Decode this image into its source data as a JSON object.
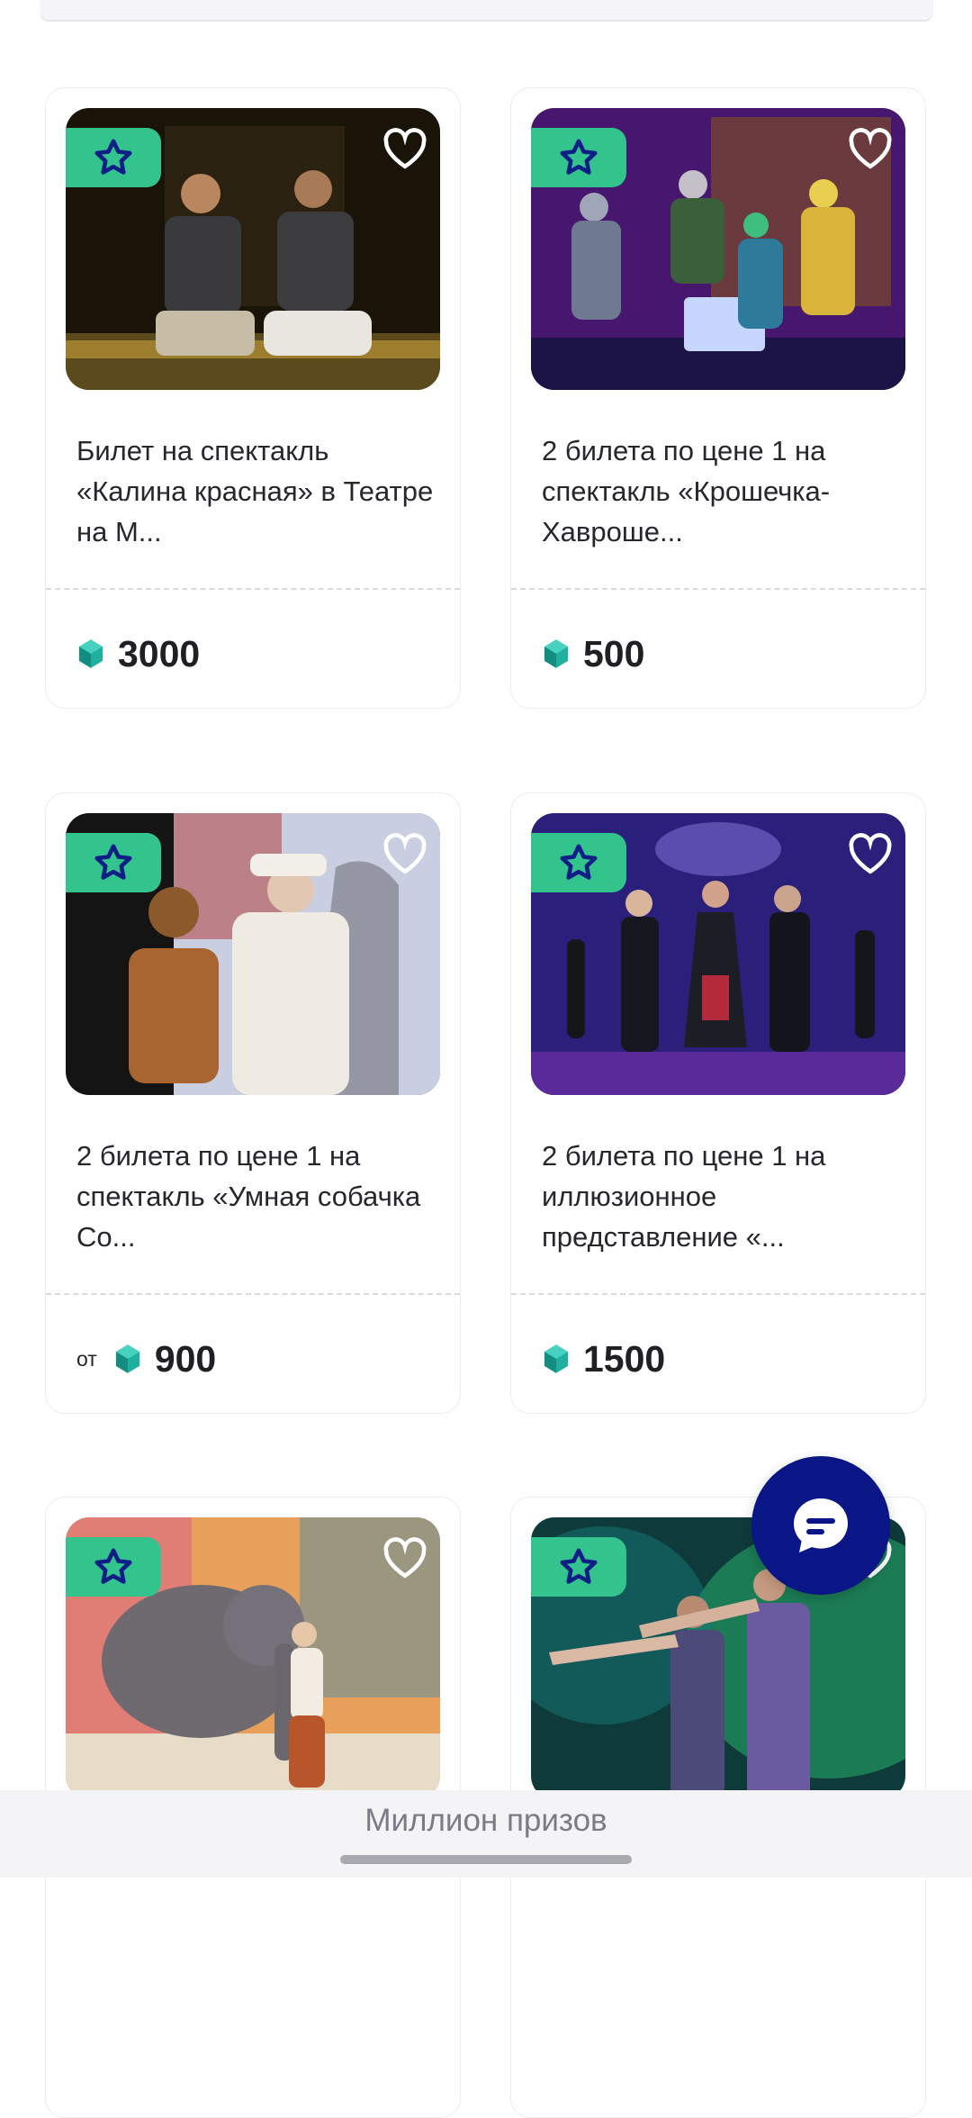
{
  "cards": [
    {
      "title": "Билет на спектакль «Калина красная» в Театре на М...",
      "price_prefix": "",
      "price": "3000",
      "image": "theater-scene-two-actors"
    },
    {
      "title": "2 билета по цене 1 на спектакль «Крошечка-Хаврошe...",
      "price_prefix": "",
      "price": "500",
      "image": "theater-scene-colorful-group"
    },
    {
      "title": "2 билета по цене 1 на спектакль «Умная собачка Со...",
      "price_prefix": "от",
      "price": "900",
      "image": "theater-scene-clowns"
    },
    {
      "title": "2 билета по цене 1 на иллюзионное представление «...",
      "price_prefix": "",
      "price": "1500",
      "image": "theater-scene-dancers"
    },
    {
      "title": "",
      "price_prefix": "",
      "price": "",
      "image": "circus-elephant"
    },
    {
      "title": "",
      "price_prefix": "",
      "price": "",
      "image": "theater-scene-green-stage"
    }
  ],
  "bottom_bar": {
    "label": "Миллион призов"
  },
  "colors": {
    "badge": "#33c48e",
    "fab": "#0a1685",
    "gem": "#1fb0a0"
  },
  "icons": {
    "badge": "star-icon",
    "favorite": "heart-icon",
    "currency": "gem-icon",
    "fab": "chat-icon"
  }
}
